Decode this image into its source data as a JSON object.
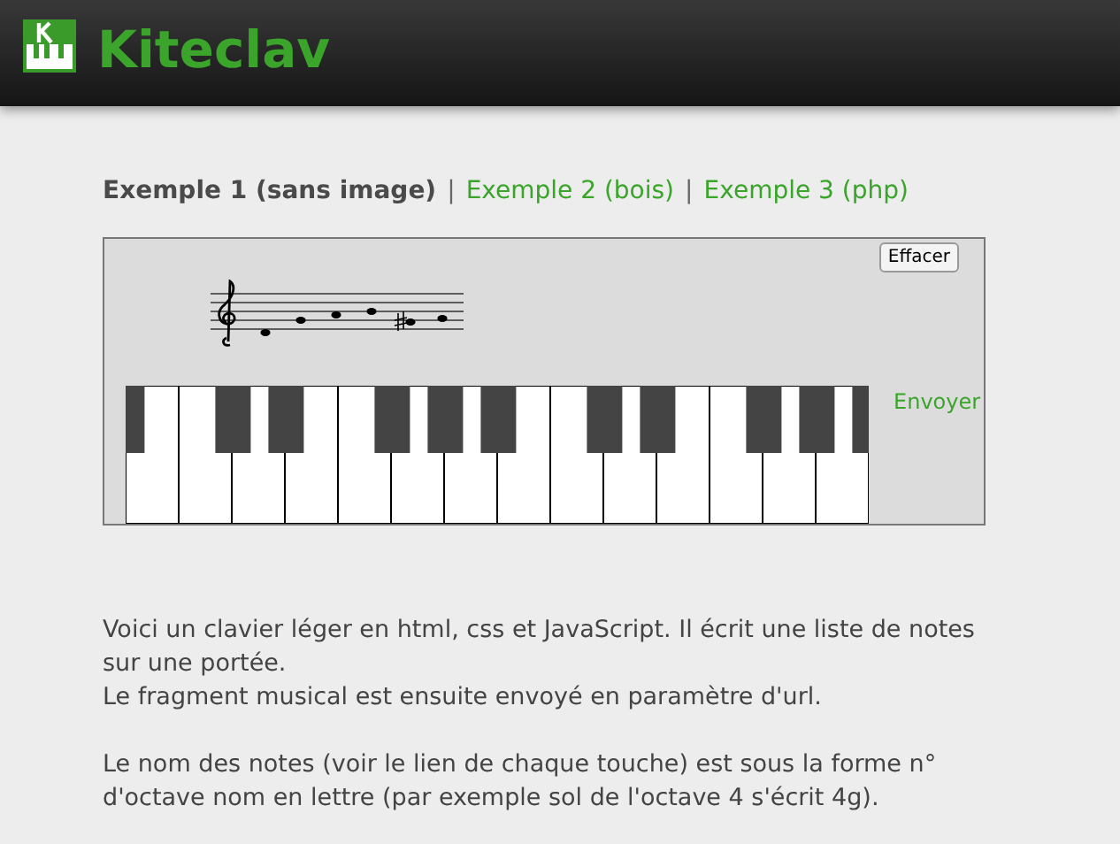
{
  "header": {
    "title": "Kiteclav"
  },
  "nav": {
    "separator": "|",
    "examples": [
      {
        "label": "Exemple 1 (sans image)",
        "selected": true
      },
      {
        "label": "Exemple 2 (bois)",
        "selected": false
      },
      {
        "label": "Exemple 3 (php)",
        "selected": false
      }
    ]
  },
  "keyboard": {
    "clear_button": "Effacer",
    "send_link": "Envoyer"
  },
  "description": [
    {
      "lines": [
        "Voici un clavier léger en html, css et JavaScript. Il écrit une liste de notes sur une portée.",
        "Le fragment musical est ensuite envoyé en paramètre d'url."
      ]
    },
    {
      "lines": [
        "Le nom des notes (voir le lien de chaque touche) est sous la forme n° d'octave nom en lettre (par exemple sol de l'octave 4 s'écrit 4g)."
      ]
    }
  ]
}
